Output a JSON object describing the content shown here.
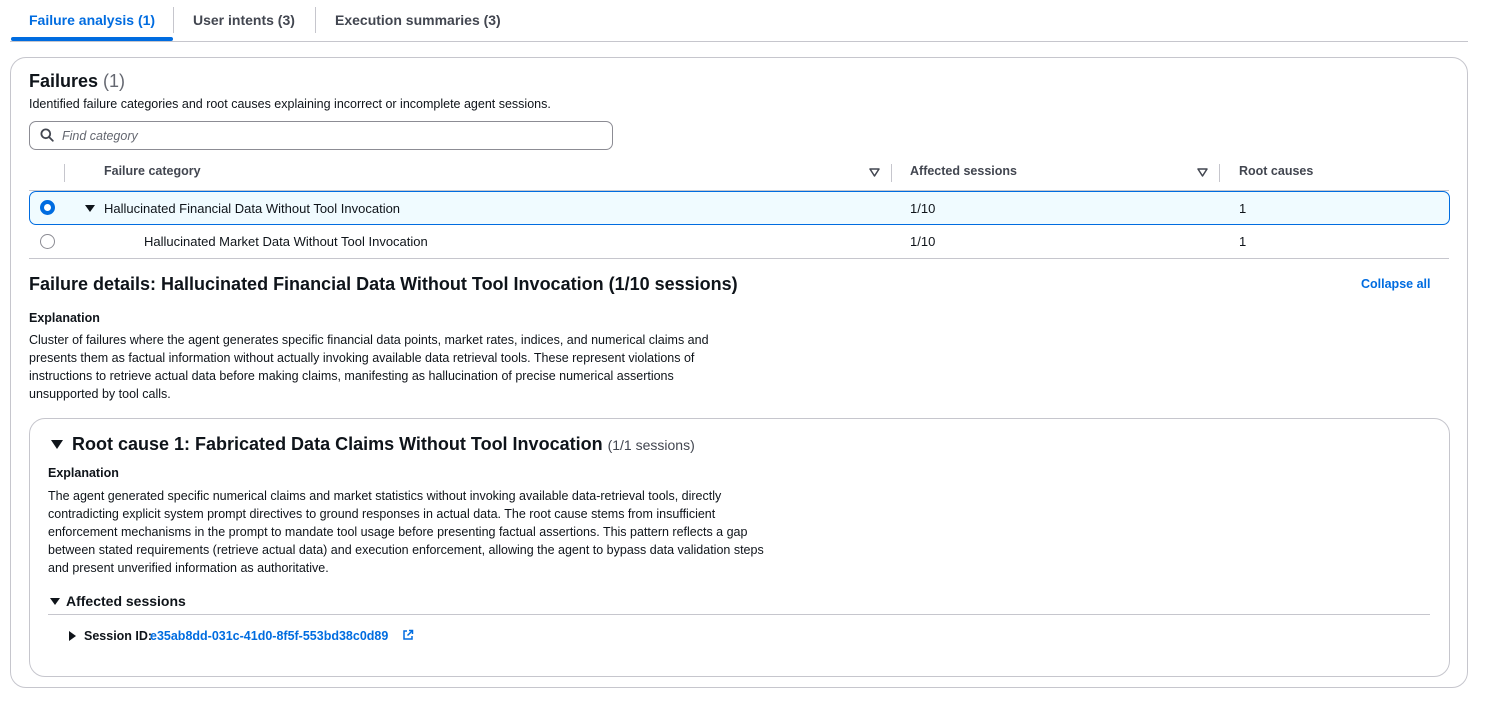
{
  "tabs": [
    {
      "label": "Failure analysis (1)",
      "active": true
    },
    {
      "label": "User intents (3)",
      "active": false
    },
    {
      "label": "Execution summaries (3)",
      "active": false
    }
  ],
  "failures": {
    "title": "Failures",
    "count": "(1)",
    "description": "Identified failure categories and root causes explaining incorrect or incomplete agent sessions.",
    "search_placeholder": "Find category"
  },
  "table": {
    "columns": [
      "Failure category",
      "Affected sessions",
      "Root causes"
    ],
    "rows": [
      {
        "category": "Hallucinated Financial Data Without Tool Invocation",
        "affected": "1/10",
        "root_causes": "1",
        "selected": true,
        "expanded": true
      },
      {
        "category": "Hallucinated Market Data Without Tool Invocation",
        "affected": "1/10",
        "root_causes": "1",
        "selected": false
      }
    ]
  },
  "details": {
    "title": "Failure details: Hallucinated Financial Data Without Tool Invocation (1/10 sessions)",
    "collapse_all": "Collapse all",
    "explanation_label": "Explanation",
    "explanation": "Cluster of failures where the agent generates specific financial data points, market rates, indices, and numerical claims and presents them as factual information without actually invoking available data retrieval tools. These represent violations of instructions to retrieve actual data before making claims, manifesting as hallucination of precise numerical assertions unsupported by tool calls."
  },
  "root_cause": {
    "title": "Root cause 1: Fabricated Data Claims Without Tool Invocation",
    "count": "(1/1 sessions)",
    "explanation_label": "Explanation",
    "explanation": "The agent generated specific numerical claims and market statistics without invoking available data-retrieval tools, directly contradicting explicit system prompt directives to ground responses in actual data. The root cause stems from insufficient enforcement mechanisms in the prompt to mandate tool usage before presenting factual assertions. This pattern reflects a gap between stated requirements (retrieve actual data) and execution enforcement, allowing the agent to bypass data validation steps and present unverified information as authoritative.",
    "affected_label": "Affected sessions",
    "session_label": "Session ID:",
    "session_id": "e35ab8dd-031c-41d0-8f5f-553bd38c0d89"
  },
  "colors": {
    "accent": "#006ce0",
    "selected_row_bg": "#f0fbff",
    "border": "#c6c6cd"
  }
}
